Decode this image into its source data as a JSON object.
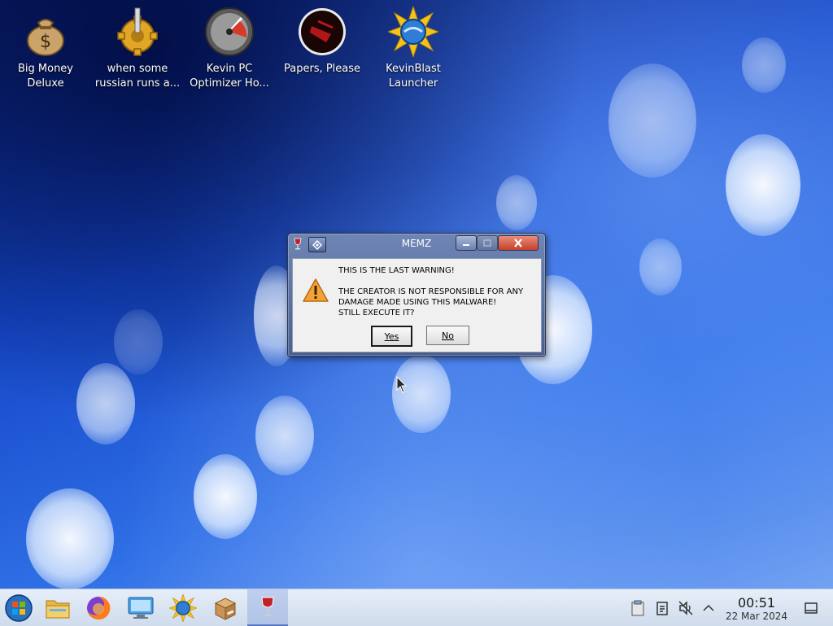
{
  "desktop": {
    "icons": [
      {
        "label": "Big Money\nDeluxe"
      },
      {
        "label": "when some\nrussian runs a..."
      },
      {
        "label": "Kevin PC\nOptimizer Ho..."
      },
      {
        "label": "Papers, Please"
      },
      {
        "label": "KevinBlast\nLauncher"
      }
    ]
  },
  "dialog": {
    "title": "MEMZ",
    "message": "THIS IS THE LAST WARNING!\n\nTHE CREATOR IS NOT RESPONSIBLE FOR ANY\nDAMAGE MADE USING THIS MALWARE!\nSTILL EXECUTE IT?",
    "yes_label": "Yes",
    "no_label": "No"
  },
  "taskbar": {
    "apps": [
      "start-orb",
      "file-manager",
      "firefox",
      "remote-desktop",
      "kevinblast",
      "package-installer",
      "wine"
    ],
    "clock": {
      "time": "00:51",
      "date": "22 Mar 2024"
    }
  },
  "colors": {
    "accent": "#1547c8",
    "taskbar": "#dfe8f4"
  }
}
